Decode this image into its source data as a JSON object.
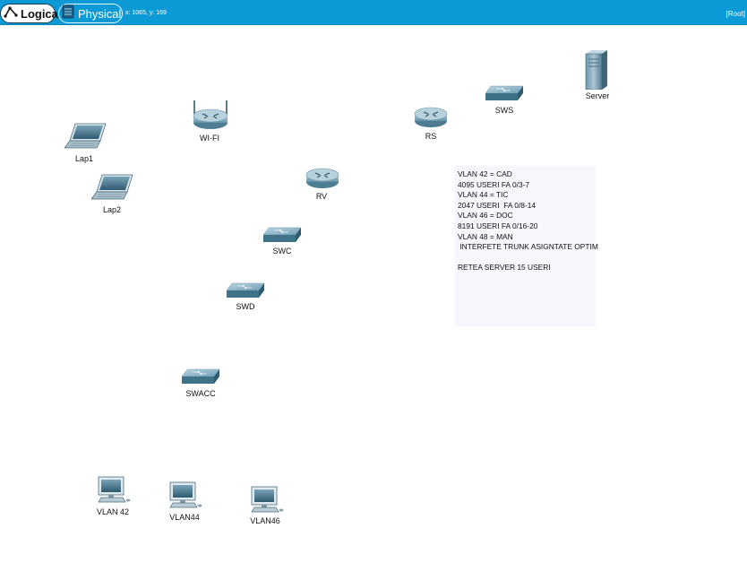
{
  "toolbar": {
    "logical_label": "Logical",
    "physical_label": "Physical",
    "coords": "x: 1065, y: 169",
    "root_label": "[Root]",
    "accent_color": "#0c9ad6"
  },
  "devices": {
    "wifi": {
      "label": "WI-FI",
      "icon": "wireless-router-icon"
    },
    "lap1": {
      "label": "Lap1",
      "icon": "laptop-icon"
    },
    "lap2": {
      "label": "Lap2",
      "icon": "laptop-icon"
    },
    "rv": {
      "label": "RV",
      "icon": "router-icon"
    },
    "rs": {
      "label": "RS",
      "icon": "router-icon"
    },
    "sws": {
      "label": "SWS",
      "icon": "switch-icon"
    },
    "server": {
      "label": "Server",
      "icon": "server-icon"
    },
    "swc": {
      "label": "SWC",
      "icon": "switch-icon"
    },
    "swd": {
      "label": "SWD",
      "icon": "switch-icon"
    },
    "swacc": {
      "label": "SWACC",
      "icon": "switch-icon"
    },
    "vlan42": {
      "label": "VLAN 42",
      "icon": "pc-icon"
    },
    "vlan44": {
      "label": "VLAN44",
      "icon": "pc-icon"
    },
    "vlan46": {
      "label": "VLAN46",
      "icon": "pc-icon"
    }
  },
  "note": {
    "lines": [
      "VLAN 42 = CAD",
      "4095 USERI FA 0/3-7",
      "VLAN 44 = TIC",
      "2047 USERI  FA 0/8-14",
      "VLAN 46 = DOC",
      "8191 USERI FA 0/16-20",
      "VLAN 48 = MAN",
      " INTERFETE TRUNK ASIGNTATE OPTIM",
      "",
      "RETEA SERVER 15 USERI"
    ]
  }
}
